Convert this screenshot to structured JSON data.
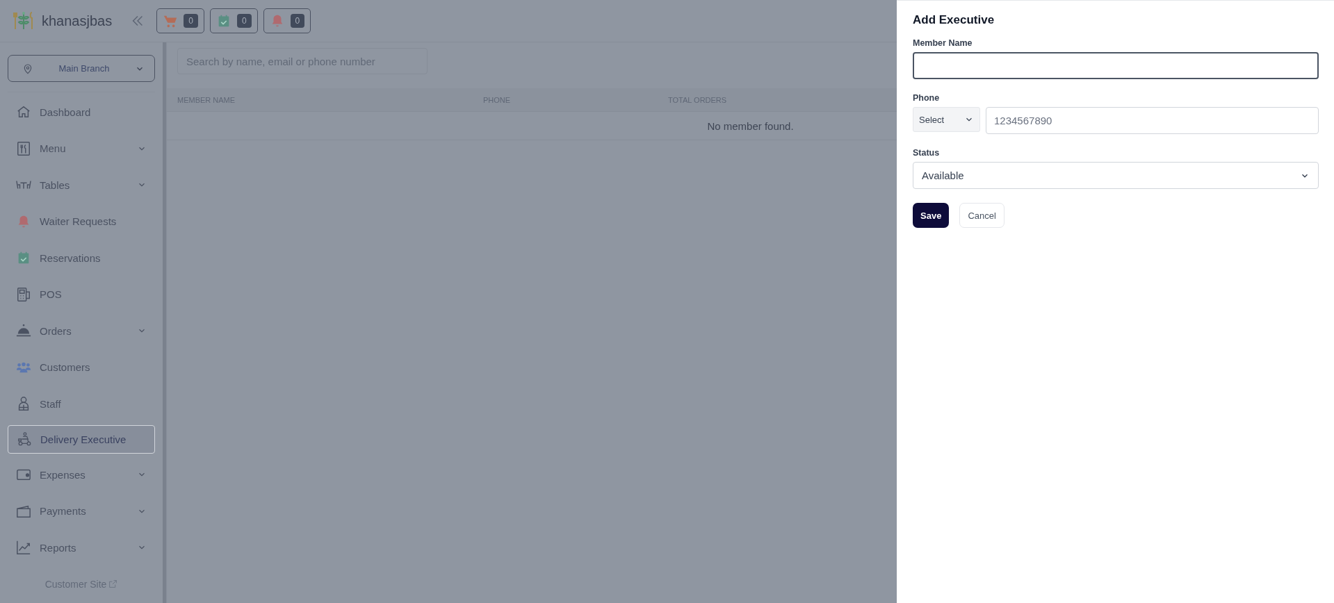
{
  "header": {
    "brand": "khanasjbas",
    "counters": [
      {
        "kind": "cart",
        "count": "0"
      },
      {
        "kind": "calendar",
        "count": "0"
      },
      {
        "kind": "bell",
        "count": "0"
      }
    ]
  },
  "sidebar": {
    "branch": "Main Branch",
    "items": [
      {
        "kind": "home",
        "label": "Dashboard",
        "expandable": false,
        "selected": false
      },
      {
        "kind": "menu",
        "label": "Menu",
        "expandable": true,
        "selected": false
      },
      {
        "kind": "tables",
        "label": "Tables",
        "expandable": true,
        "selected": false
      },
      {
        "kind": "bell",
        "label": "Waiter Requests",
        "expandable": false,
        "selected": false
      },
      {
        "kind": "calendar",
        "label": "Reservations",
        "expandable": false,
        "selected": false
      },
      {
        "kind": "pos",
        "label": "POS",
        "expandable": false,
        "selected": false
      },
      {
        "kind": "cloche",
        "label": "Orders",
        "expandable": true,
        "selected": false
      },
      {
        "kind": "users",
        "label": "Customers",
        "expandable": false,
        "selected": false
      },
      {
        "kind": "staff",
        "label": "Staff",
        "expandable": false,
        "selected": false
      },
      {
        "kind": "scooter",
        "label": "Delivery Executive",
        "expandable": false,
        "selected": true
      },
      {
        "kind": "wallet",
        "label": "Expenses",
        "expandable": true,
        "selected": false
      },
      {
        "kind": "folder",
        "label": "Payments",
        "expandable": true,
        "selected": false
      },
      {
        "kind": "chart",
        "label": "Reports",
        "expandable": true,
        "selected": false
      }
    ],
    "footer_link": "Customer Site"
  },
  "main": {
    "search": {
      "placeholder": "Search by name, email or phone number"
    },
    "table": {
      "columns": [
        "MEMBER NAME",
        "PHONE",
        "TOTAL ORDERS"
      ],
      "empty_message": "No member found."
    }
  },
  "drawer": {
    "title": "Add Executive",
    "fields": [
      {
        "kind": "text",
        "label": "Member Name",
        "focused": true
      },
      {
        "kind": "phone",
        "label": "Phone",
        "code": "Select",
        "placeholder": "1234567890"
      },
      {
        "kind": "select",
        "label": "Status",
        "value": "Available"
      }
    ],
    "buttons": [
      {
        "kind": "primary",
        "label": "Save"
      },
      {
        "kind": "secondary",
        "label": "Cancel"
      }
    ]
  }
}
